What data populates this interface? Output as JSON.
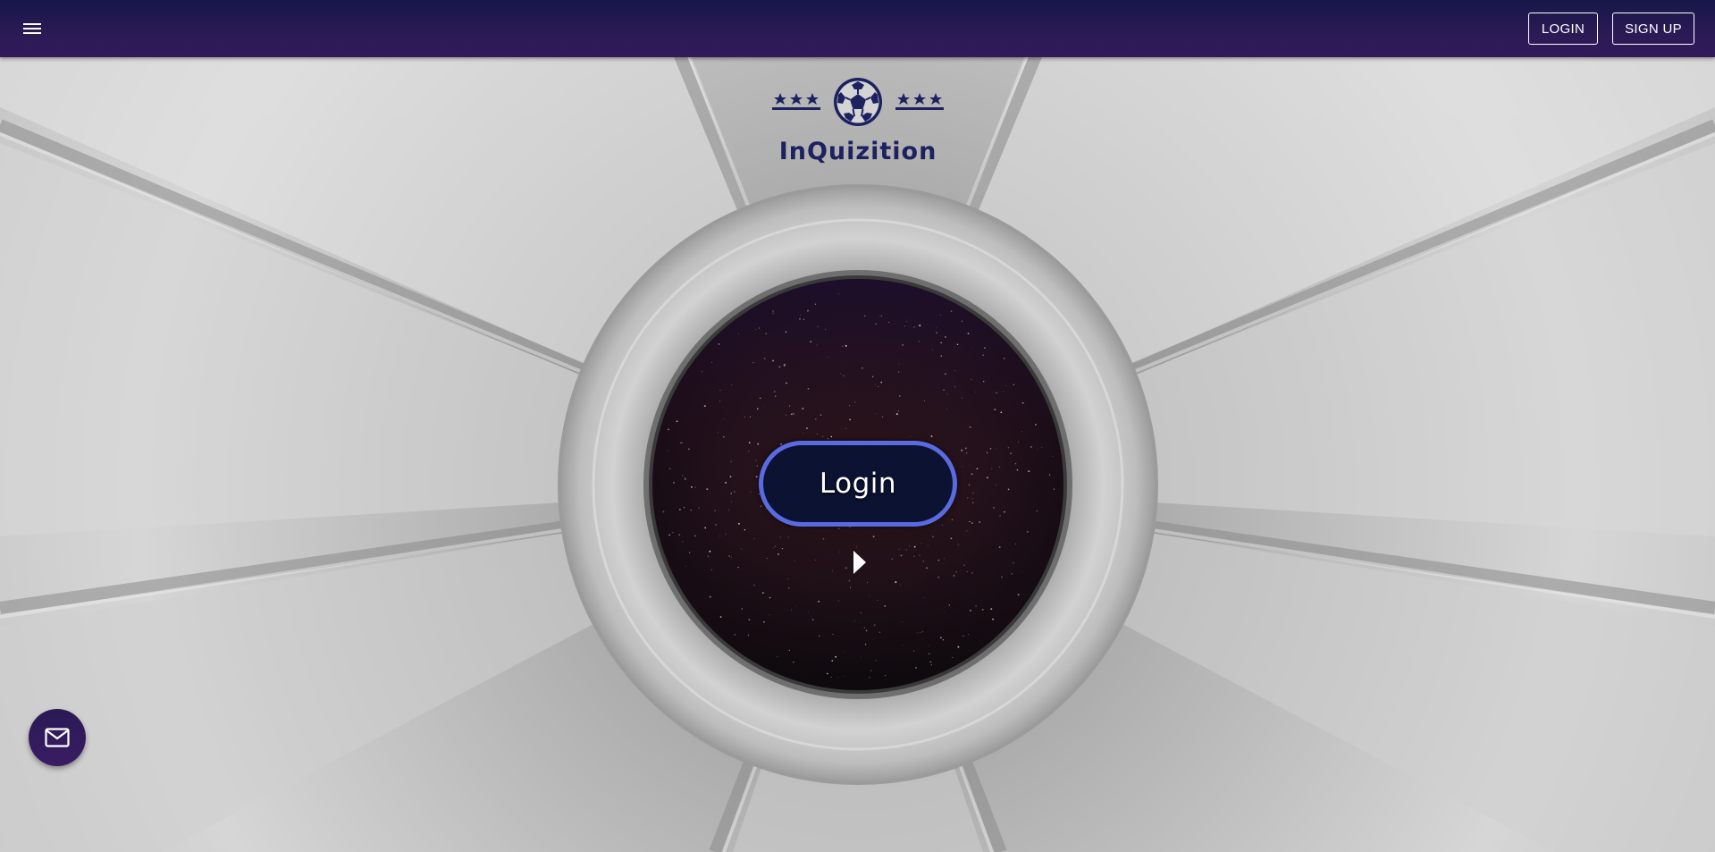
{
  "header": {
    "menu_icon": "hamburger-menu-icon",
    "login_label": "LOGIN",
    "signup_label": "SIGN UP"
  },
  "brand": {
    "name": "InQuizition",
    "logo_icon": "soccer-ball-with-stars-icon"
  },
  "hero": {
    "login_button_label": "Login",
    "arrow_icon": "play-triangle-icon"
  },
  "fab": {
    "icon": "mail-envelope-icon"
  },
  "colors": {
    "header_bg": "#1d1852",
    "brand_text": "#1d2160",
    "login_border": "#5a6ae0",
    "login_fill": "#0c1232",
    "fab_bg": "#2e1a5a"
  }
}
